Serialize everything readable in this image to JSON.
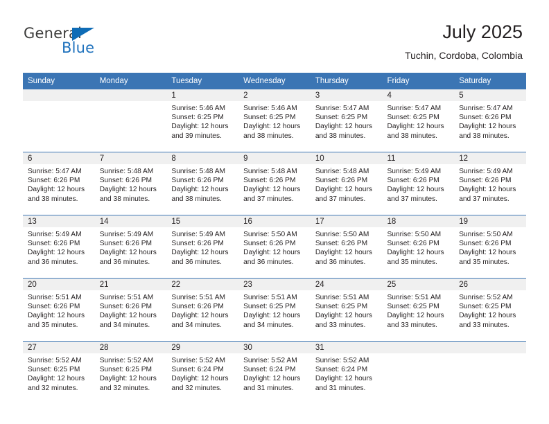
{
  "brand": {
    "name_part1": "General",
    "name_part2": "Blue",
    "flag_icon": "triangle-flag-icon",
    "color_dark": "#3c3c3b",
    "color_blue": "#1f72bd"
  },
  "header": {
    "month_title": "July 2025",
    "location": "Tuchin, Cordoba, Colombia",
    "accent_color": "#3b75b4",
    "band_color": "#f0f0f0"
  },
  "weekday_headers": [
    "Sunday",
    "Monday",
    "Tuesday",
    "Wednesday",
    "Thursday",
    "Friday",
    "Saturday"
  ],
  "weeks": [
    [
      {
        "day": "",
        "sunrise": "",
        "sunset": "",
        "daylight1": "",
        "daylight2": ""
      },
      {
        "day": "",
        "sunrise": "",
        "sunset": "",
        "daylight1": "",
        "daylight2": ""
      },
      {
        "day": "1",
        "sunrise": "Sunrise: 5:46 AM",
        "sunset": "Sunset: 6:25 PM",
        "daylight1": "Daylight: 12 hours",
        "daylight2": "and 39 minutes."
      },
      {
        "day": "2",
        "sunrise": "Sunrise: 5:46 AM",
        "sunset": "Sunset: 6:25 PM",
        "daylight1": "Daylight: 12 hours",
        "daylight2": "and 38 minutes."
      },
      {
        "day": "3",
        "sunrise": "Sunrise: 5:47 AM",
        "sunset": "Sunset: 6:25 PM",
        "daylight1": "Daylight: 12 hours",
        "daylight2": "and 38 minutes."
      },
      {
        "day": "4",
        "sunrise": "Sunrise: 5:47 AM",
        "sunset": "Sunset: 6:25 PM",
        "daylight1": "Daylight: 12 hours",
        "daylight2": "and 38 minutes."
      },
      {
        "day": "5",
        "sunrise": "Sunrise: 5:47 AM",
        "sunset": "Sunset: 6:26 PM",
        "daylight1": "Daylight: 12 hours",
        "daylight2": "and 38 minutes."
      }
    ],
    [
      {
        "day": "6",
        "sunrise": "Sunrise: 5:47 AM",
        "sunset": "Sunset: 6:26 PM",
        "daylight1": "Daylight: 12 hours",
        "daylight2": "and 38 minutes."
      },
      {
        "day": "7",
        "sunrise": "Sunrise: 5:48 AM",
        "sunset": "Sunset: 6:26 PM",
        "daylight1": "Daylight: 12 hours",
        "daylight2": "and 38 minutes."
      },
      {
        "day": "8",
        "sunrise": "Sunrise: 5:48 AM",
        "sunset": "Sunset: 6:26 PM",
        "daylight1": "Daylight: 12 hours",
        "daylight2": "and 38 minutes."
      },
      {
        "day": "9",
        "sunrise": "Sunrise: 5:48 AM",
        "sunset": "Sunset: 6:26 PM",
        "daylight1": "Daylight: 12 hours",
        "daylight2": "and 37 minutes."
      },
      {
        "day": "10",
        "sunrise": "Sunrise: 5:48 AM",
        "sunset": "Sunset: 6:26 PM",
        "daylight1": "Daylight: 12 hours",
        "daylight2": "and 37 minutes."
      },
      {
        "day": "11",
        "sunrise": "Sunrise: 5:49 AM",
        "sunset": "Sunset: 6:26 PM",
        "daylight1": "Daylight: 12 hours",
        "daylight2": "and 37 minutes."
      },
      {
        "day": "12",
        "sunrise": "Sunrise: 5:49 AM",
        "sunset": "Sunset: 6:26 PM",
        "daylight1": "Daylight: 12 hours",
        "daylight2": "and 37 minutes."
      }
    ],
    [
      {
        "day": "13",
        "sunrise": "Sunrise: 5:49 AM",
        "sunset": "Sunset: 6:26 PM",
        "daylight1": "Daylight: 12 hours",
        "daylight2": "and 36 minutes."
      },
      {
        "day": "14",
        "sunrise": "Sunrise: 5:49 AM",
        "sunset": "Sunset: 6:26 PM",
        "daylight1": "Daylight: 12 hours",
        "daylight2": "and 36 minutes."
      },
      {
        "day": "15",
        "sunrise": "Sunrise: 5:49 AM",
        "sunset": "Sunset: 6:26 PM",
        "daylight1": "Daylight: 12 hours",
        "daylight2": "and 36 minutes."
      },
      {
        "day": "16",
        "sunrise": "Sunrise: 5:50 AM",
        "sunset": "Sunset: 6:26 PM",
        "daylight1": "Daylight: 12 hours",
        "daylight2": "and 36 minutes."
      },
      {
        "day": "17",
        "sunrise": "Sunrise: 5:50 AM",
        "sunset": "Sunset: 6:26 PM",
        "daylight1": "Daylight: 12 hours",
        "daylight2": "and 36 minutes."
      },
      {
        "day": "18",
        "sunrise": "Sunrise: 5:50 AM",
        "sunset": "Sunset: 6:26 PM",
        "daylight1": "Daylight: 12 hours",
        "daylight2": "and 35 minutes."
      },
      {
        "day": "19",
        "sunrise": "Sunrise: 5:50 AM",
        "sunset": "Sunset: 6:26 PM",
        "daylight1": "Daylight: 12 hours",
        "daylight2": "and 35 minutes."
      }
    ],
    [
      {
        "day": "20",
        "sunrise": "Sunrise: 5:51 AM",
        "sunset": "Sunset: 6:26 PM",
        "daylight1": "Daylight: 12 hours",
        "daylight2": "and 35 minutes."
      },
      {
        "day": "21",
        "sunrise": "Sunrise: 5:51 AM",
        "sunset": "Sunset: 6:26 PM",
        "daylight1": "Daylight: 12 hours",
        "daylight2": "and 34 minutes."
      },
      {
        "day": "22",
        "sunrise": "Sunrise: 5:51 AM",
        "sunset": "Sunset: 6:26 PM",
        "daylight1": "Daylight: 12 hours",
        "daylight2": "and 34 minutes."
      },
      {
        "day": "23",
        "sunrise": "Sunrise: 5:51 AM",
        "sunset": "Sunset: 6:25 PM",
        "daylight1": "Daylight: 12 hours",
        "daylight2": "and 34 minutes."
      },
      {
        "day": "24",
        "sunrise": "Sunrise: 5:51 AM",
        "sunset": "Sunset: 6:25 PM",
        "daylight1": "Daylight: 12 hours",
        "daylight2": "and 33 minutes."
      },
      {
        "day": "25",
        "sunrise": "Sunrise: 5:51 AM",
        "sunset": "Sunset: 6:25 PM",
        "daylight1": "Daylight: 12 hours",
        "daylight2": "and 33 minutes."
      },
      {
        "day": "26",
        "sunrise": "Sunrise: 5:52 AM",
        "sunset": "Sunset: 6:25 PM",
        "daylight1": "Daylight: 12 hours",
        "daylight2": "and 33 minutes."
      }
    ],
    [
      {
        "day": "27",
        "sunrise": "Sunrise: 5:52 AM",
        "sunset": "Sunset: 6:25 PM",
        "daylight1": "Daylight: 12 hours",
        "daylight2": "and 32 minutes."
      },
      {
        "day": "28",
        "sunrise": "Sunrise: 5:52 AM",
        "sunset": "Sunset: 6:25 PM",
        "daylight1": "Daylight: 12 hours",
        "daylight2": "and 32 minutes."
      },
      {
        "day": "29",
        "sunrise": "Sunrise: 5:52 AM",
        "sunset": "Sunset: 6:24 PM",
        "daylight1": "Daylight: 12 hours",
        "daylight2": "and 32 minutes."
      },
      {
        "day": "30",
        "sunrise": "Sunrise: 5:52 AM",
        "sunset": "Sunset: 6:24 PM",
        "daylight1": "Daylight: 12 hours",
        "daylight2": "and 31 minutes."
      },
      {
        "day": "31",
        "sunrise": "Sunrise: 5:52 AM",
        "sunset": "Sunset: 6:24 PM",
        "daylight1": "Daylight: 12 hours",
        "daylight2": "and 31 minutes."
      },
      {
        "day": "",
        "sunrise": "",
        "sunset": "",
        "daylight1": "",
        "daylight2": ""
      },
      {
        "day": "",
        "sunrise": "",
        "sunset": "",
        "daylight1": "",
        "daylight2": ""
      }
    ]
  ]
}
